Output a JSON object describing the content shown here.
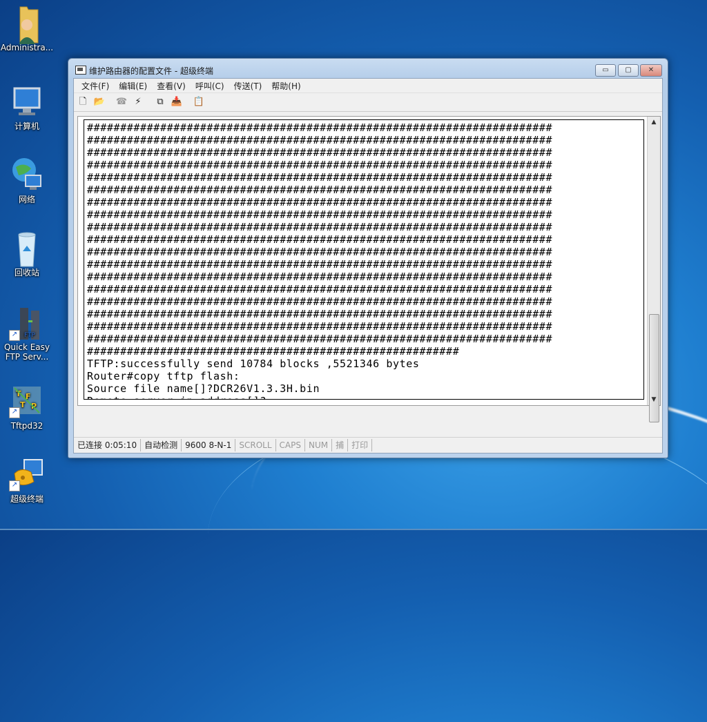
{
  "desktop": {
    "icons": [
      {
        "label": "Administra...",
        "icon": "user-folder-icon"
      },
      {
        "label": "计算机",
        "icon": "computer-icon"
      },
      {
        "label": "网络",
        "icon": "network-icon"
      },
      {
        "label": "回收站",
        "icon": "recycle-bin-icon"
      },
      {
        "label": "Quick Easy\nFTP Serv...",
        "icon": "ftp-server-icon"
      },
      {
        "label": "Tftpd32",
        "icon": "tftpd-icon"
      },
      {
        "label": "超级终端",
        "icon": "hyperterminal-icon"
      }
    ]
  },
  "window": {
    "title": "维护路由器的配置文件 - 超级终端",
    "controls": {
      "minimize": "▭",
      "maximize": "▢",
      "close": "✕"
    },
    "menu": [
      "文件(F)",
      "编辑(E)",
      "查看(V)",
      "呼叫(C)",
      "传送(T)",
      "帮助(H)"
    ],
    "toolbar": [
      {
        "icon": "new-file-icon",
        "glyph": "🗋"
      },
      {
        "icon": "open-folder-icon",
        "glyph": "📂"
      },
      {
        "icon": "phone-icon",
        "glyph": "☎"
      },
      {
        "icon": "disconnect-icon",
        "glyph": "⚡"
      },
      {
        "icon": "send-icon",
        "glyph": "⧉"
      },
      {
        "icon": "receive-icon",
        "glyph": "📥"
      },
      {
        "icon": "properties-icon",
        "glyph": "📋"
      }
    ],
    "terminal": {
      "hash_lines": 19,
      "hash_width": 70,
      "last_hash_width": 56,
      "lines": [
        "TFTP:successfully send 10784 blocks ,5521346 bytes",
        "Router#copy tftp flash:",
        "Source file name[]?DCR26V1.3.3H.bin",
        "Remote-server ip address[]?"
      ]
    },
    "status": {
      "connected": "已连接 0:05:10",
      "detect": "自动检测",
      "baud": "9600 8-N-1",
      "scroll": "SCROLL",
      "caps": "CAPS",
      "num": "NUM",
      "capture": "捕",
      "print": "打印"
    }
  }
}
